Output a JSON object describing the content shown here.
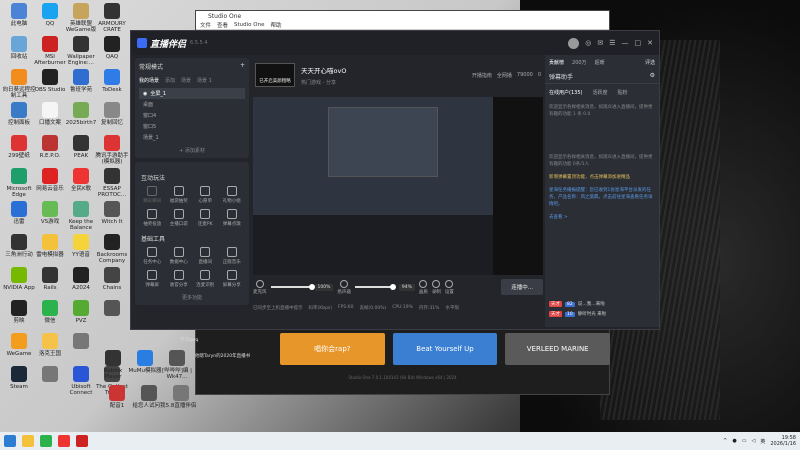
{
  "desktop": {
    "icons": [
      {
        "label": "此电脑",
        "color": "#4b83d6",
        "col": 0,
        "row": 0
      },
      {
        "label": "QQ",
        "color": "#1aa3f0",
        "col": 1,
        "row": 0
      },
      {
        "label": "英雄联盟WeGame版",
        "color": "#c7a45b",
        "col": 2,
        "row": 0
      },
      {
        "label": "ARMOURY CRATE",
        "color": "#333",
        "col": 3,
        "row": 0
      },
      {
        "label": "回收站",
        "color": "#6aa5d8",
        "col": 0,
        "row": 1
      },
      {
        "label": "MSI Afterburner",
        "color": "#c22",
        "col": 1,
        "row": 1
      },
      {
        "label": "Wallpaper Engine:...",
        "color": "#333",
        "col": 2,
        "row": 1
      },
      {
        "label": "QAQ",
        "color": "#222",
        "col": 3,
        "row": 1
      },
      {
        "label": "向日葵远程控制工具",
        "color": "#f28c1d",
        "col": 0,
        "row": 2
      },
      {
        "label": "OBS Studio",
        "color": "#222",
        "col": 1,
        "row": 2
      },
      {
        "label": "鲁班学苑",
        "color": "#2f6dd1",
        "col": 2,
        "row": 2
      },
      {
        "label": "ToDesk",
        "color": "#2f7be8",
        "col": 3,
        "row": 2
      },
      {
        "label": "控制面板",
        "color": "#3a7bc8",
        "col": 0,
        "row": 3
      },
      {
        "label": "口播文案",
        "color": "#f5f5f5",
        "col": 1,
        "row": 3
      },
      {
        "label": "2025birth7",
        "color": "#7a5",
        "col": 2,
        "row": 3
      },
      {
        "label": "复制回忆",
        "color": "#888",
        "col": 3,
        "row": 3
      },
      {
        "label": "299壁纸",
        "color": "#d33",
        "col": 0,
        "row": 4
      },
      {
        "label": "R.E.P.O.",
        "color": "#b33",
        "col": 1,
        "row": 4
      },
      {
        "label": "PEAK",
        "color": "#333",
        "col": 2,
        "row": 4
      },
      {
        "label": "腾讯手游助手(模拟器)",
        "color": "#d33",
        "col": 3,
        "row": 4
      },
      {
        "label": "Microsoft Edge",
        "color": "#1e9e6a",
        "col": 0,
        "row": 5
      },
      {
        "label": "网易云音乐",
        "color": "#d22",
        "col": 1,
        "row": 5
      },
      {
        "label": "全民K歌",
        "color": "#e33",
        "col": 2,
        "row": 5
      },
      {
        "label": "ESSAP PROTOC...",
        "color": "#333",
        "col": 3,
        "row": 5
      },
      {
        "label": "迅雷",
        "color": "#2a6fd6",
        "col": 0,
        "row": 6
      },
      {
        "label": "VS游戏",
        "color": "#6b5",
        "col": 1,
        "row": 6
      },
      {
        "label": "Keep the Balance",
        "color": "#5a8",
        "col": 2,
        "row": 6
      },
      {
        "label": "Witch It",
        "color": "#555",
        "col": 3,
        "row": 6
      },
      {
        "label": "三角洲行动",
        "color": "#333",
        "col": 0,
        "row": 7
      },
      {
        "label": "雷电模拟器",
        "color": "#f3c23a",
        "col": 1,
        "row": 7
      },
      {
        "label": "YY语音",
        "color": "#f5d33a",
        "col": 2,
        "row": 7
      },
      {
        "label": "Backrooms Company",
        "color": "#222",
        "col": 3,
        "row": 7
      },
      {
        "label": "NVIDIA App",
        "color": "#76b900",
        "col": 0,
        "row": 8
      },
      {
        "label": "Rails",
        "color": "#333",
        "col": 1,
        "row": 8
      },
      {
        "label": "A2024",
        "color": "#222",
        "col": 2,
        "row": 8
      },
      {
        "label": "Chains",
        "color": "#444",
        "col": 3,
        "row": 8
      },
      {
        "label": "剪映",
        "color": "#222",
        "col": 0,
        "row": 9
      },
      {
        "label": "微信",
        "color": "#2bb24c",
        "col": 1,
        "row": 9
      },
      {
        "label": "PVZ",
        "color": "#5a3",
        "col": 2,
        "row": 9
      },
      {
        "label": "",
        "color": "#555",
        "col": 3,
        "row": 9
      },
      {
        "label": "WeGame",
        "color": "#f29d1d",
        "col": 0,
        "row": 10
      },
      {
        "label": "洛克王国",
        "color": "#f5c24a",
        "col": 1,
        "row": 10
      },
      {
        "label": "",
        "color": "#777",
        "col": 2,
        "row": 10
      },
      {
        "label": "Steam",
        "color": "#1b2838",
        "col": 0,
        "row": 11
      },
      {
        "label": "",
        "color": "#777",
        "col": 1,
        "row": 11
      },
      {
        "label": "Ubisoft Connect",
        "color": "#2a55d6",
        "col": 2,
        "row": 11
      },
      {
        "label": "The Outlast Trials",
        "color": "#444",
        "col": 3,
        "row": 11
      }
    ],
    "bottom_icons": [
      {
        "label": "Roblox Player",
        "color": "#333"
      },
      {
        "label": "MuMu模拟器",
        "color": "#2a7de1"
      },
      {
        "label": "[哔哔哔]编 | Wk47...",
        "color": "#555"
      },
      {
        "label": "配音1",
        "color": "#c33"
      },
      {
        "label": "给您人试问我",
        "color": "#555"
      },
      {
        "label": "5.8直播伴侣",
        "color": "#777"
      }
    ],
    "mid_labels": [
      "学习qwq",
      "他嗯Taryn的2020年直播书"
    ]
  },
  "studio_one": {
    "title": "Studio One",
    "menu": [
      "文件",
      "查看",
      "Studio One",
      "帮助"
    ],
    "footer": "Studio One 7.0.1.104143 (64 Bit) Windows x64 | 2024",
    "banners": [
      {
        "text": "唱你会rap?",
        "color": "#e7962a"
      },
      {
        "text": "Beat Yourself Up",
        "color": "#3b7fd3"
      },
      {
        "text": "VERLEED MARINE",
        "color": "#5a5a5a"
      }
    ]
  },
  "app": {
    "logo": "直播伴侣",
    "version": "6.5.5.4",
    "top_right_icons": [
      "avatar",
      "headset-icon",
      "mail-icon",
      "settings-icon",
      "minimize-icon",
      "maximize-icon",
      "close-icon"
    ],
    "left": {
      "mode": "常规模式",
      "tabs": [
        "我的场景",
        "添加",
        "场景",
        "场景 1"
      ],
      "scenes": [
        "全屏_1",
        "桌面",
        "窗口4",
        "窗口5",
        "场景_1"
      ],
      "add_source": "+ 添加素材",
      "interact_title": "互动玩法",
      "interact_tools": [
        "精彩瞬间",
        "福袋抽奖",
        "心愿单",
        "礼物小组",
        "抽奖投放",
        "主播口袋",
        "连麦PK",
        "弹幕点歌"
      ],
      "basic_title": "基础工具",
      "basic_tools": [
        "任务中心",
        "数据中心",
        "直播间",
        "正版音乐",
        "弹幕屏",
        "收官分享",
        "连麦识别",
        "屏幕分享"
      ],
      "more": "更多功能"
    },
    "center": {
      "thumb_label": "已开启美颜粗略",
      "stream_title": "天天开心喵ovO",
      "sub_title": "热门游戏 - 分享",
      "right_stats": [
        "开播指南",
        "全网播",
        "79000",
        "0"
      ],
      "mic_label": "麦克风",
      "mic_pct": "100%",
      "speaker_label": "扬声器",
      "speaker_pct": "94%",
      "actions": [
        "画质",
        "录制",
        "设置"
      ],
      "live_button": "连播中...",
      "status": [
        "已同步至上机直播中提示",
        "码率(Kbps)",
        "FPS:60",
        "丢帧(0.00%)",
        "CPU:19%",
        "内存:31%",
        "水平限"
      ]
    },
    "right": {
      "tabs": [
        "贡献榜",
        "200万",
        "超暖"
      ],
      "badge_text": "评选",
      "header": "弹幕助手",
      "sub_tabs": [
        "在线用户(135)",
        "活跃度",
        "贴粉"
      ],
      "messages": [
        "欢迎显示各样相关消息，如观众进入直播间，提供更有趣的功能 1 条 0.0",
        "欢迎显示各样相关消息，如观众进入直播间，提供更有趣的功能 0条/1人"
      ],
      "hl_msg": "新增弹幕置顶功能，点击弹幕添加进精品",
      "blue_msg": "星海任务播报提醒：您已收到1张星海平台派发的任务，产品名称：风之旅典，点击前往星海查看任务详情吧。",
      "look": "去查看 >",
      "chats": [
        {
          "badge": "天才",
          "badge2": "82",
          "name": "说…我…来啦"
        },
        {
          "badge": "天才",
          "badge2": "10",
          "name": "静听时光 来啦"
        }
      ]
    }
  },
  "taskbar": {
    "time": "19:58",
    "date": "2026/1/16",
    "lang": "英"
  }
}
